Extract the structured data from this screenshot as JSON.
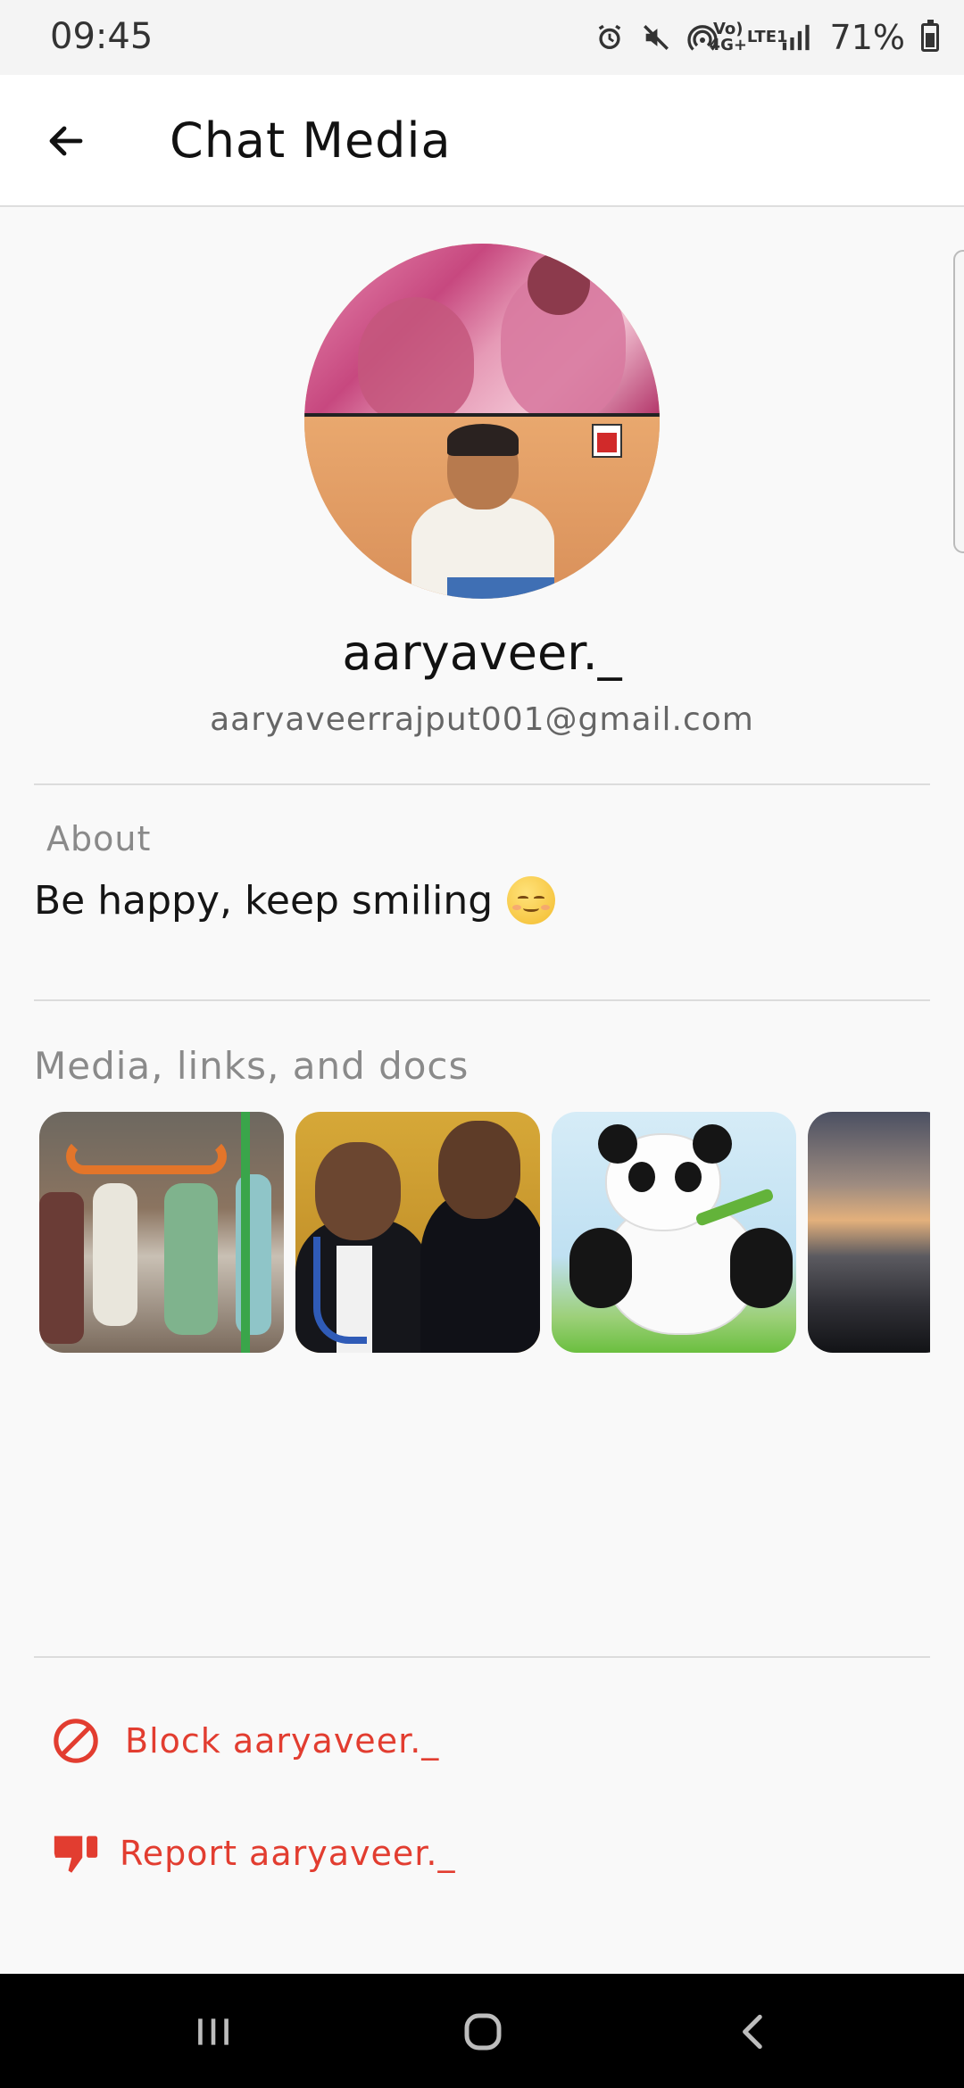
{
  "status_bar": {
    "time": "09:45",
    "network_label_top": "Vo) 4G+",
    "network_label_bottom": "LTE1",
    "battery_text": "71%"
  },
  "app_bar": {
    "title": "Chat Media",
    "back_icon": "arrow-left-icon"
  },
  "profile": {
    "name": "aaryaveer._",
    "email": "aaryaveerrajput001@gmail.com"
  },
  "about": {
    "label": "About",
    "text": "Be happy, keep smiling",
    "emoji_icon": "relieved-face-emoji"
  },
  "media": {
    "label": "Media, links, and docs"
  },
  "actions": {
    "block_label": "Block aaryaveer._",
    "report_label": "Report aaryaveer._"
  },
  "colors": {
    "danger": "#e23d30",
    "background": "#f9f9f9",
    "app_bar": "#ffffff",
    "nav_bar": "#000000"
  }
}
